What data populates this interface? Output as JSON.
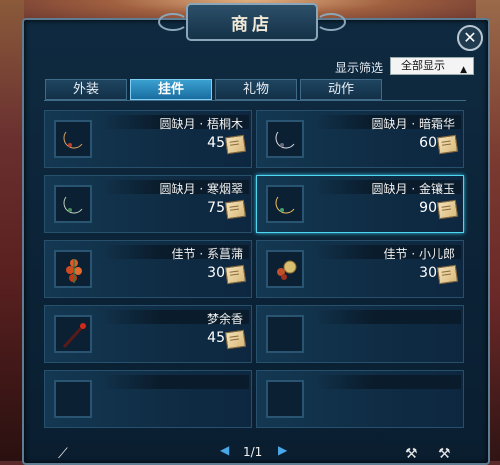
{
  "window": {
    "title": "商店"
  },
  "filter": {
    "label": "显示筛选",
    "selected": "全部显示"
  },
  "tabs": [
    {
      "label": "外装",
      "active": false
    },
    {
      "label": "挂件",
      "active": true
    },
    {
      "label": "礼物",
      "active": false
    },
    {
      "label": "动作",
      "active": false
    }
  ],
  "items": [
    {
      "name": "圆缺月 · 梧桐木",
      "price": "45",
      "icon": "crescent-moon-pendant-icon"
    },
    {
      "name": "圆缺月 · 暗霜华",
      "price": "60",
      "icon": "crescent-moon-pendant-icon"
    },
    {
      "name": "圆缺月 · 寒烟翠",
      "price": "75",
      "icon": "crescent-moon-pendant-icon"
    },
    {
      "name": "圆缺月 · 金镶玉",
      "price": "90",
      "icon": "crescent-moon-pendant-icon"
    },
    {
      "name": "佳节 · 系菖蒲",
      "price": "30",
      "icon": "flower-charm-icon"
    },
    {
      "name": "佳节 · 小儿郎",
      "price": "30",
      "icon": "festival-charm-icon"
    },
    {
      "name": "梦余香",
      "price": "45",
      "icon": "incense-stick-icon"
    }
  ],
  "pagination": {
    "text": "1/1"
  },
  "colors": {
    "accent": "#3aa0d0",
    "selected_border": "#4fd6f0",
    "panel": "#0f2a40"
  }
}
